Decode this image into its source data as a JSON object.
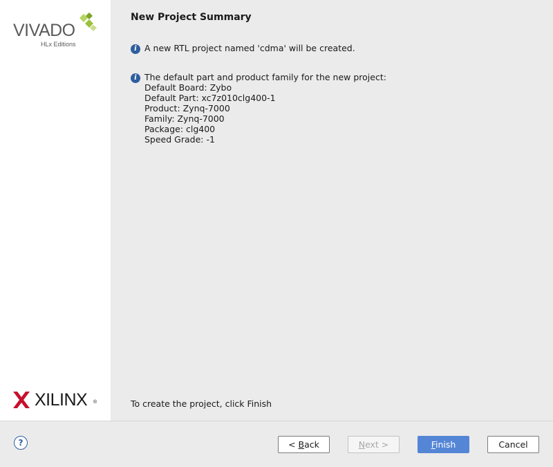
{
  "branding": {
    "vivado_word": "VIVADO",
    "vivado_sub": "HLx Editions",
    "xilinx_word": "XILINX",
    "xilinx_reg": "®"
  },
  "page": {
    "title": "New Project Summary",
    "info_rtl": "A new RTL project named 'cdma' will be created.",
    "info_part_lines": [
      "The default part and product family for the new project:",
      "Default Board: Zybo",
      "Default Part: xc7z010clg400-1",
      "Product: Zynq-7000",
      "Family: Zynq-7000",
      "Package: clg400",
      "Speed Grade: -1"
    ],
    "finish_hint": "To create the project, click Finish"
  },
  "footer": {
    "help_label": "?",
    "back_prefix": "< ",
    "back_mnemonic": "B",
    "back_rest": "ack",
    "next_mnemonic": "N",
    "next_rest": "ext >",
    "finish_mnemonic": "F",
    "finish_rest": "inish",
    "cancel_label": "Cancel"
  },
  "icons": {
    "info": "info-icon",
    "help": "help-icon"
  },
  "colors": {
    "accent": "#5586d6",
    "info_icon": "#2f5e9e",
    "xilinx_red": "#c8102e",
    "vivado_green": "#9ac13c"
  }
}
